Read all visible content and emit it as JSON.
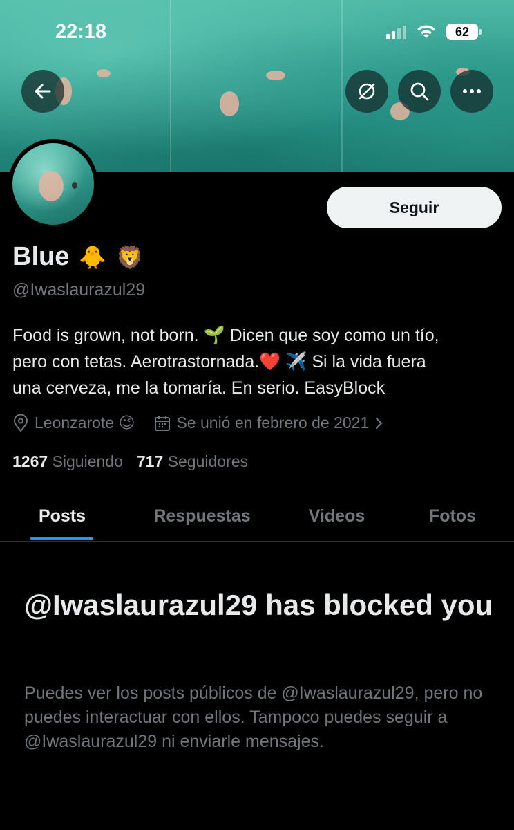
{
  "status_bar": {
    "time": "22:18",
    "battery": "62"
  },
  "profile": {
    "name": "Blue",
    "name_emojis": [
      "🐥",
      "🦁"
    ],
    "handle": "@Iwaslaurazul29",
    "bio_lines": [
      "Food is grown, not born. 🌱 Dicen que soy como un tío,",
      "pero con tetas. Aerotrastornada.❤️ ✈️ Si la vida fuera",
      "una cerveza, me la tomaría. En serio. EasyBlock"
    ],
    "location": "Leonzarote 😉",
    "joined": "Se unió en febrero de 2021",
    "following_count": "1267",
    "following_label": "Siguiendo",
    "followers_count": "717",
    "followers_label": "Seguidores"
  },
  "actions": {
    "follow_label": "Seguir"
  },
  "tabs": [
    {
      "label": "Posts",
      "active": true
    },
    {
      "label": "Respuestas",
      "active": false
    },
    {
      "label": "Videos",
      "active": false
    },
    {
      "label": "Fotos",
      "active": false
    }
  ],
  "blocked": {
    "title": "@Iwaslaurazul29 has blocked you",
    "description": "Puedes ver los posts públicos de @Iwaslaurazul29, pero no puedes interactuar con ellos. Tampoco puedes seguir a @Iwaslaurazul29 ni enviarle mensajes."
  },
  "icons": {
    "back": "arrow-left-icon",
    "grok": "grok-icon",
    "search": "search-icon",
    "more": "more-icon",
    "location": "location-pin-icon",
    "calendar": "calendar-icon",
    "chevron": "chevron-right-icon"
  },
  "colors": {
    "accent": "#1d9bf0",
    "muted": "#71767b",
    "text": "#e7e9ea",
    "background": "#000000"
  }
}
